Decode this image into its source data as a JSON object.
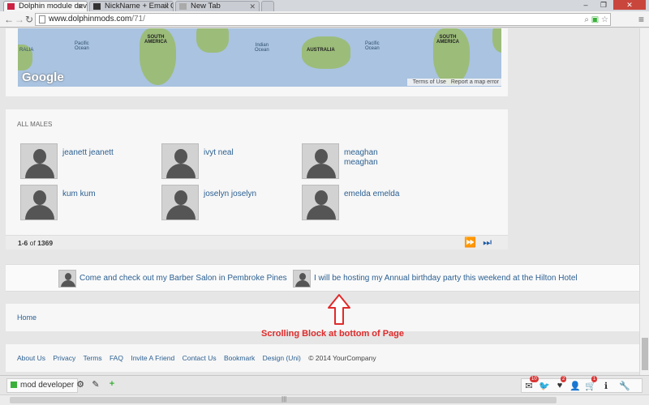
{
  "browser": {
    "tabs": [
      {
        "label": "Dolphin module dev",
        "active": true
      },
      {
        "label": "NickName + Email C",
        "active": false
      },
      {
        "label": "New Tab",
        "active": false
      }
    ],
    "url_host": "www.dolphinmods.com",
    "url_path": "/71/"
  },
  "map": {
    "labels": {
      "pacific_left": "Pacific\nOcean",
      "south_america_1": "SOUTH\nAMERICA",
      "indian_ocean": "Indian\nOcean",
      "australia_1": "AUSTRALIA",
      "pacific_right": "Pacific\nOcean",
      "south_america_2": "SOUTH\nAMERICA",
      "australia_left": "RALIA"
    },
    "logo": "Google",
    "terms": "Terms of Use",
    "report": "Report a map error"
  },
  "males": {
    "title": "ALL MALES",
    "members": [
      {
        "name": "jeanett jeanett"
      },
      {
        "name": "ivyt neal"
      },
      {
        "name": "meaghan meaghan"
      },
      {
        "name": "kum kum"
      },
      {
        "name": "joselyn joselyn"
      },
      {
        "name": "emelda emelda"
      }
    ],
    "pager": {
      "range": "1-6",
      "of": "of",
      "total": "1369"
    }
  },
  "scroll_block": {
    "posts": [
      {
        "text": "Come and check out my Barber Salon in Pembroke Pines"
      },
      {
        "text": "I will be hosting my Annual birthday party this weekend at the Hilton Hotel"
      }
    ]
  },
  "annotation": {
    "text": "Scrolling Block at bottom of Page",
    "color": "#e02b2b"
  },
  "nav": {
    "home": "Home"
  },
  "footer": {
    "links": [
      "About Us",
      "Privacy",
      "Terms",
      "FAQ",
      "Invite A Friend",
      "Contact Us",
      "Bookmark",
      "Design (Uni)"
    ],
    "copyright": "© 2014 YourCompany"
  },
  "toolbar": {
    "user": "mod developer",
    "badges": {
      "mail": "10",
      "heart": "2",
      "cart": "1"
    }
  },
  "colors": {
    "link": "#2b5f91",
    "accent_green": "#3ab03a",
    "badge_red": "#d93636"
  }
}
